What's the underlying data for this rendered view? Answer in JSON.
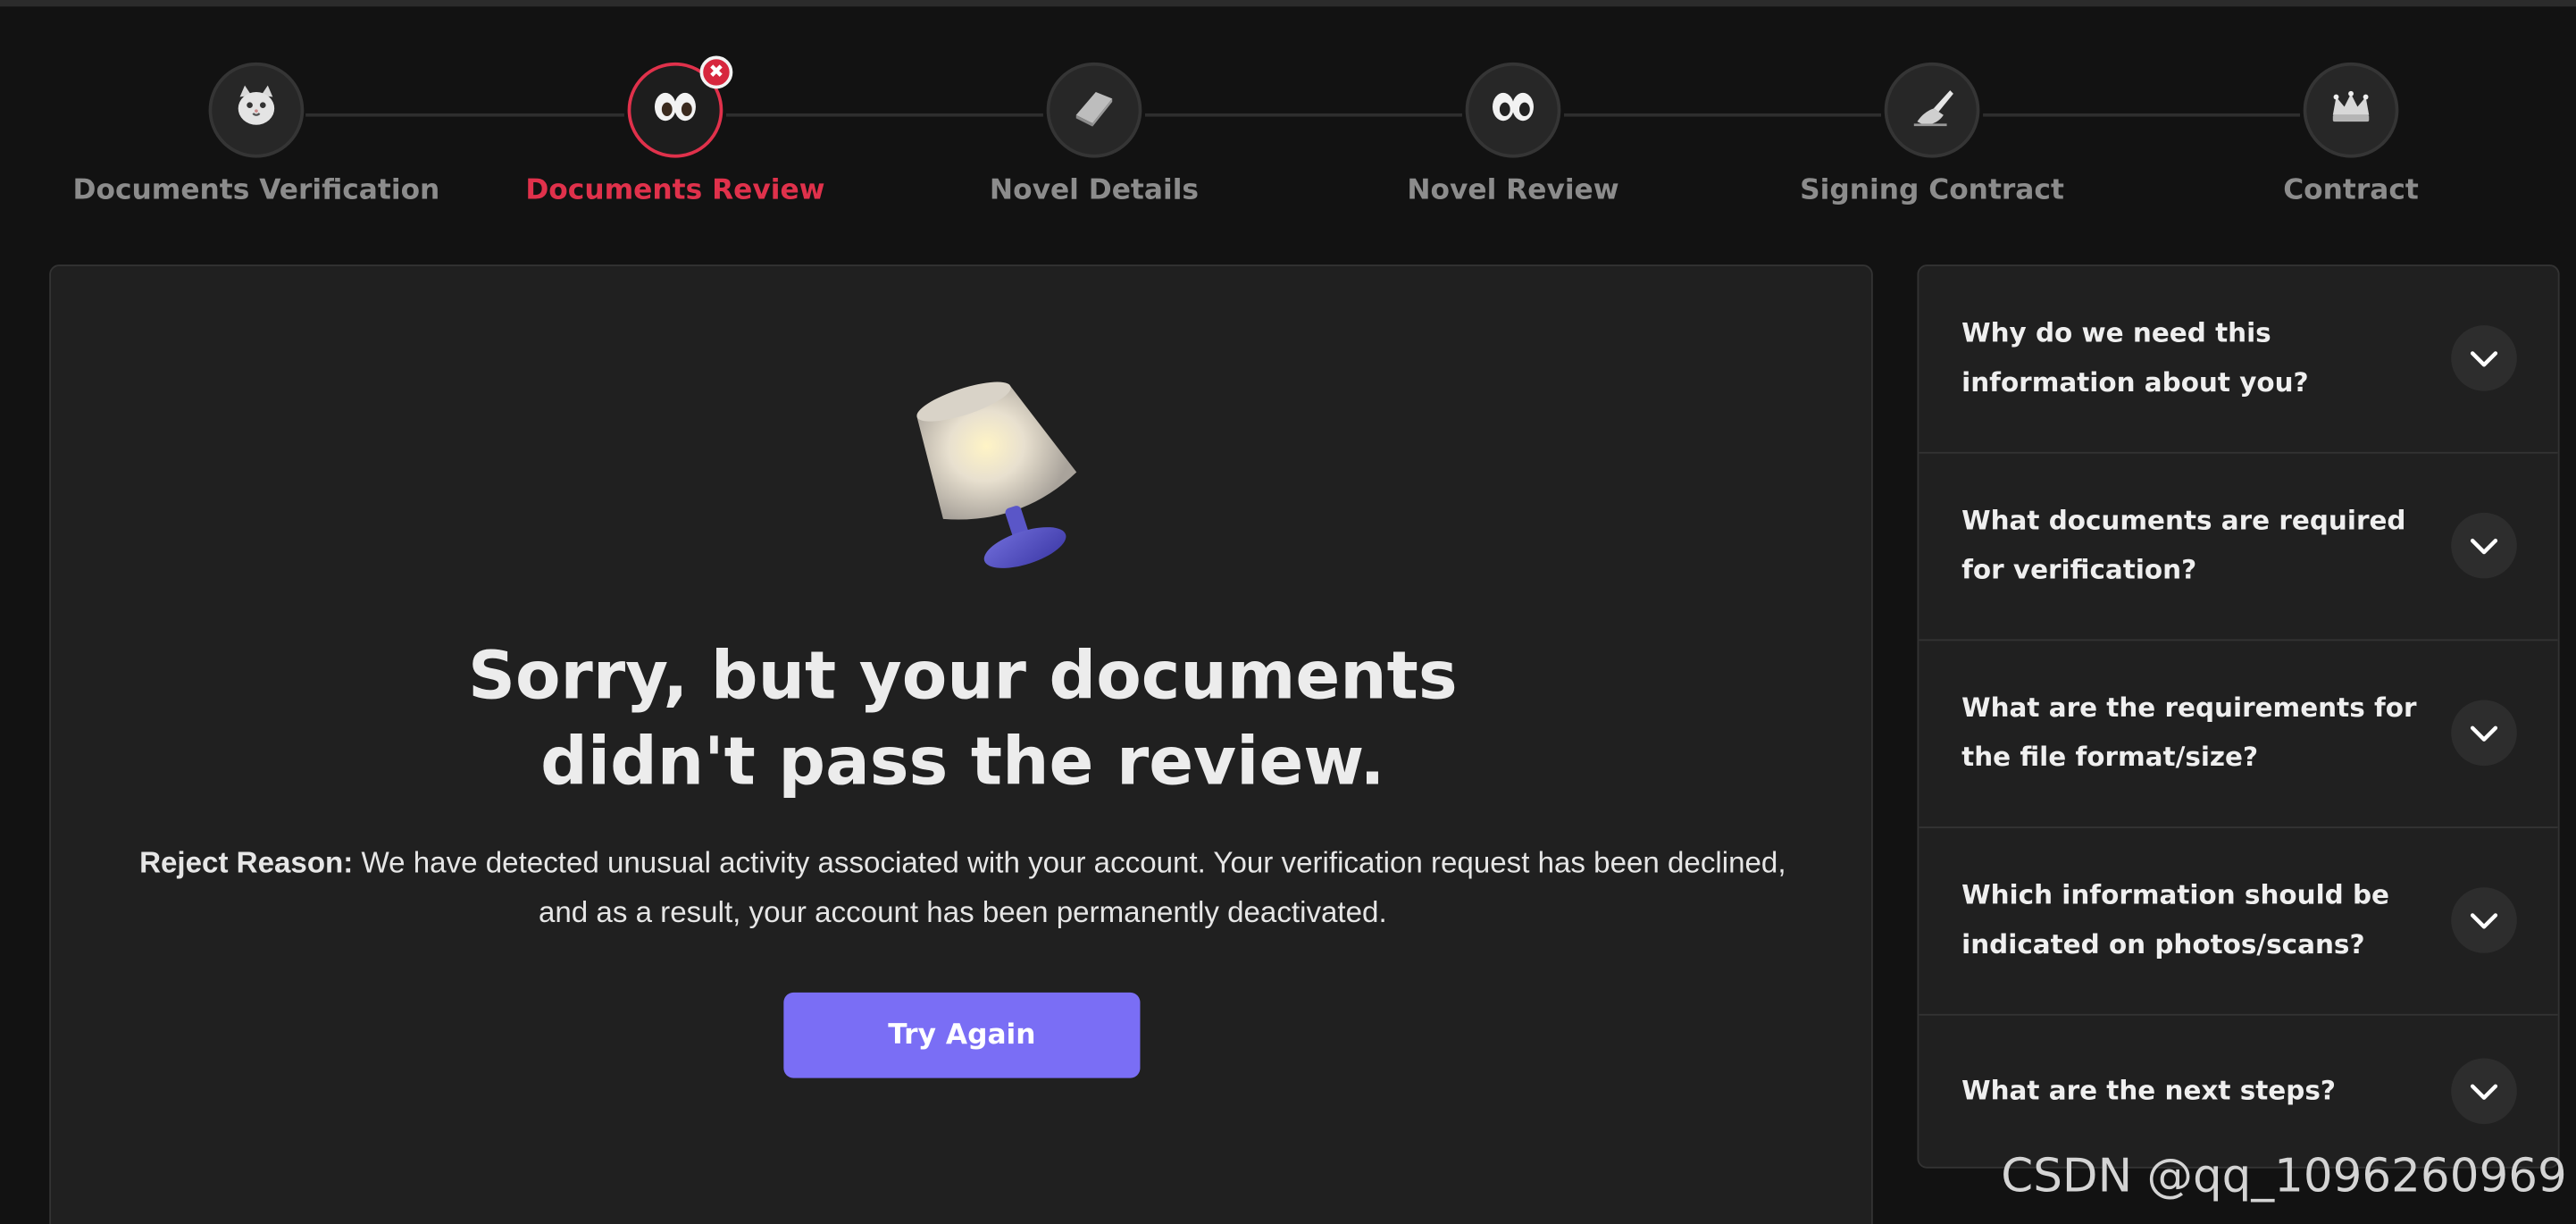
{
  "stepper": {
    "steps": [
      {
        "label": "Documents Verification",
        "icon": "cat-face-icon",
        "state": "done"
      },
      {
        "label": "Documents Review",
        "icon": "eyes-icon",
        "state": "error"
      },
      {
        "label": "Novel Details",
        "icon": "notebook-icon",
        "state": "pending"
      },
      {
        "label": "Novel Review",
        "icon": "eyes-icon",
        "state": "pending"
      },
      {
        "label": "Signing Contract",
        "icon": "writing-hand-icon",
        "state": "pending"
      },
      {
        "label": "Contract",
        "icon": "crown-icon",
        "state": "pending"
      }
    ],
    "error_badge": "✖"
  },
  "main": {
    "illustration": "tipped-lamp-icon",
    "headline_line1": "Sorry, but your documents",
    "headline_line2": "didn't pass the review.",
    "reject_label": "Reject Reason:",
    "reject_text": " We have detected unusual activity associated with your account. Your verification request has been declined, and as a result, your account has been permanently deactivated.",
    "button_label": "Try Again"
  },
  "faq": {
    "items": [
      {
        "question": "Why do we need this information about you?"
      },
      {
        "question": "What documents are required for verification?"
      },
      {
        "question": "What are the requirements for the file format/size?"
      },
      {
        "question": "Which information should be indicated on photos/scans?"
      },
      {
        "question": "What are the next steps?"
      }
    ]
  },
  "watermark": "CSDN @qq_1096260969",
  "colors": {
    "background": "#121212",
    "card": "#202020",
    "accent_error": "#e0314b",
    "button": "#7a6ef5",
    "inactive_text": "#8c8c8c"
  }
}
